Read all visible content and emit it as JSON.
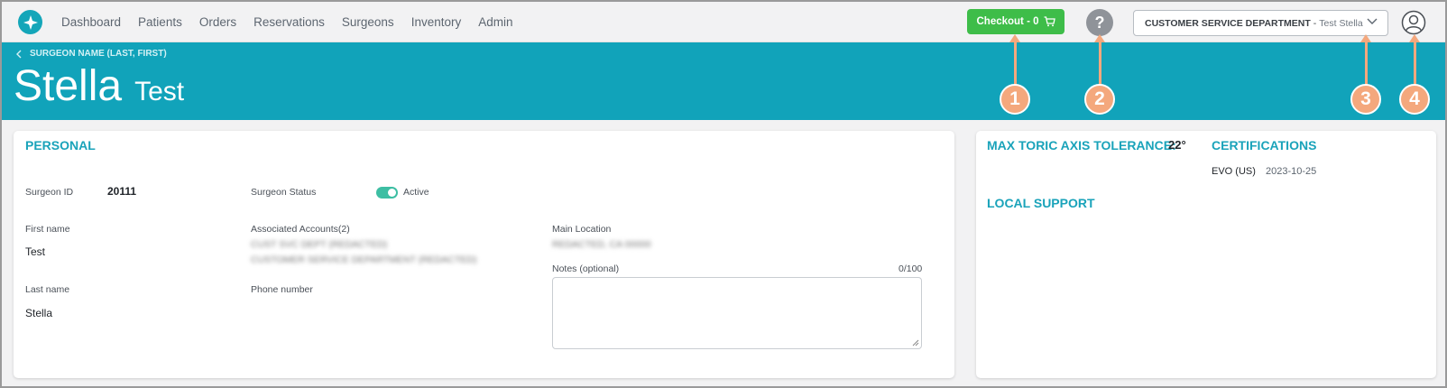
{
  "nav": {
    "links": [
      "Dashboard",
      "Patients",
      "Orders",
      "Reservations",
      "Surgeons",
      "Inventory",
      "Admin"
    ],
    "checkout_label": "Checkout - 0",
    "help_label": "?",
    "department": {
      "name": "CUSTOMER SERVICE DEPARTMENT",
      "separator": "-",
      "user": "Test Stella"
    }
  },
  "banner": {
    "back_label": "SURGEON NAME (LAST, FIRST)",
    "name_first": "Stella",
    "name_last": "Test"
  },
  "annotations": [
    "1",
    "2",
    "3",
    "4"
  ],
  "personal": {
    "title": "PERSONAL",
    "surgeon_id_label": "Surgeon ID",
    "surgeon_id": "20111",
    "status_label": "Surgeon Status",
    "status_value": "Active",
    "first_name_label": "First name",
    "first_name": "Test",
    "last_name_label": "Last name",
    "last_name": "Stella",
    "accounts_label": "Associated Accounts(2)",
    "accounts": [
      "CUST SVC DEPT (REDACTED)",
      "CUSTOMER SERVICE DEPARTMENT (REDACTED)"
    ],
    "phone_label": "Phone number",
    "main_location_label": "Main Location",
    "main_location": "REDACTED, CA 00000",
    "notes_label": "Notes (optional)",
    "notes_count": "0/100"
  },
  "right": {
    "toric_label": "MAX TORIC AXIS TOLERANCE:",
    "toric_value": "22°",
    "cert_title": "CERTIFICATIONS",
    "cert_name": "EVO (US)",
    "cert_date": "2023-10-25",
    "local_support_title": "LOCAL SUPPORT"
  },
  "colors": {
    "teal": "#11a3ba",
    "checkout_green": "#3ebd49",
    "annotation_orange": "#f4a87d",
    "toggle_green": "#3dbea3"
  }
}
